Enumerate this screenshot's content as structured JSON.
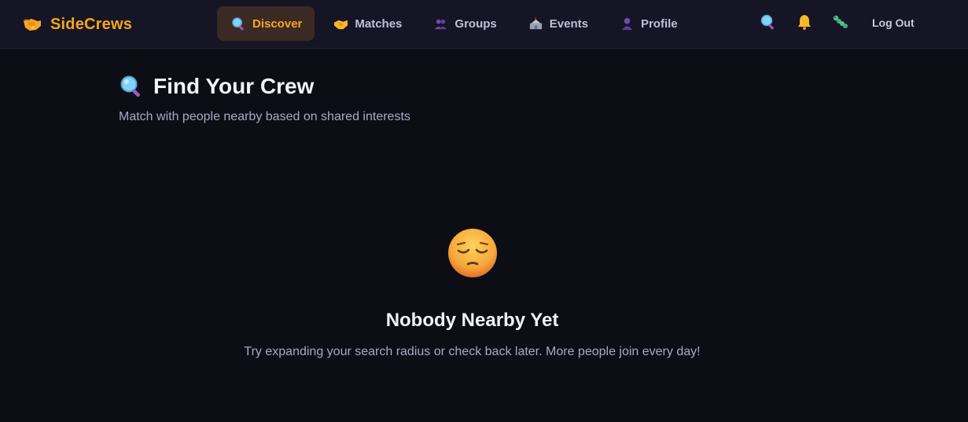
{
  "brand": {
    "name": "SideCrews",
    "icon": "handshake-fist-icon",
    "color": "#f7a61c"
  },
  "nav": {
    "items": [
      {
        "label": "Discover",
        "icon": "magnifier-icon",
        "active": true
      },
      {
        "label": "Matches",
        "icon": "handshake-icon",
        "active": false
      },
      {
        "label": "Groups",
        "icon": "people-icon",
        "active": false
      },
      {
        "label": "Events",
        "icon": "stadium-icon",
        "active": false
      },
      {
        "label": "Profile",
        "icon": "person-icon",
        "active": false
      }
    ],
    "active_color": "#f5a623"
  },
  "header_actions": {
    "icons": [
      "search-icon",
      "bell-icon",
      "caterpillar-icon"
    ],
    "logout_label": "Log Out"
  },
  "page": {
    "title": "Find Your Crew",
    "title_icon": "magnifier-icon",
    "subtitle": "Match with people nearby based on shared interests"
  },
  "empty_state": {
    "icon": "pensive-face-icon",
    "title": "Nobody Nearby Yet",
    "message": "Try expanding your search radius or check back later. More people join every day!"
  }
}
